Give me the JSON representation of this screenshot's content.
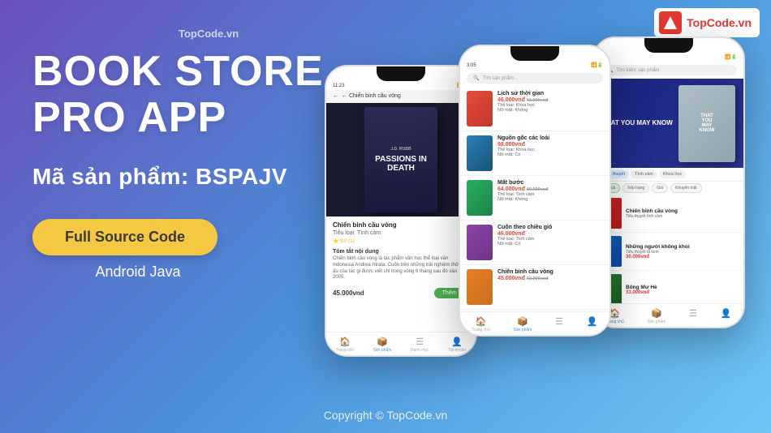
{
  "brand": {
    "logo_text": "T",
    "name_part1": "Top",
    "name_part2": "Code.vn",
    "watermark": "TopCode.vn"
  },
  "left": {
    "title_line1": "BOOK STORE",
    "title_line2": "PRO APP",
    "product_label": "Mã sản phẩm: BSPAJV",
    "btn_label": "Full Source Code",
    "platform": "Android Java"
  },
  "footer": {
    "copyright": "Copyright © TopCode.vn"
  },
  "phone_left": {
    "status_time": "11:23",
    "header": "← Chiến binh cầu vòng",
    "book_author": "J.D. ROBB",
    "book_title": "PASSIONS IN DEATH",
    "book_name": "Chiến binh cầu vòng",
    "genre": "Tiểu loại: Tình cảm",
    "rating": "⭐ 9.0 (1)",
    "summary_title": "Tóm tắt nội dung",
    "summary": "Chiến binh cầu vòng là tác phẩm văn học thể loại văn Indonesia Andrea Hirata. Cuốn trên những trải nghiệm thời thơ ấu của tác gi được viết chỉ trong vòng 6 tháng sau đó vào năm 2005.",
    "price": "45.000vnd",
    "add_btn": "Thêm v",
    "nav_items": [
      "Trang chủ",
      "Sản phẩm",
      "Danh mục",
      "Tài khoản"
    ]
  },
  "phone_middle": {
    "status_time": "3:05",
    "search_placeholder": "Tìm sản phẩm...",
    "books": [
      {
        "title": "Lịch sử thời gian",
        "price": "46.000vnđ",
        "old_price": "60.000vnđ",
        "type": "Thể loại: Khoa học",
        "borrow": "Nữ mặt: Không"
      },
      {
        "title": "Nguồn gốc các loài",
        "price": "98.000vnđ",
        "old_price": "",
        "type": "Thể loại: Khoa học",
        "borrow": "Nữ mặt: Có"
      },
      {
        "title": "Mất bước",
        "price": "64.000vnđ",
        "old_price": "80.000vnđ",
        "type": "Thể loại: Tình cảm",
        "borrow": "Nữ mặt: Không"
      },
      {
        "title": "Cuốn theo chiều gió",
        "price": "46.000vnđ",
        "old_price": "",
        "type": "Thể loại: Tình cảm",
        "borrow": "Nữ mặt: Có"
      },
      {
        "title": "Chiến binh cầu vòng",
        "price": "45.000vnđ",
        "old_price": "60.000vnđ",
        "type": "",
        "borrow": ""
      }
    ],
    "nav_items": [
      "Trang chủ",
      "Sản phẩm",
      "Danh mục",
      "Tài khoản"
    ]
  },
  "phone_right": {
    "search_placeholder": "Tìm kiếm sản phẩm",
    "featured_label": "THAT YOU\nMAY KNOW",
    "categories": [
      "Tiểu thuyết",
      "Tình cảm",
      "Khoa học"
    ],
    "active_cat": "Tiểu thuyết",
    "filters": [
      "Tất cả",
      "Xếp hạng",
      "Giá",
      "Khuyến mãi"
    ],
    "books": [
      {
        "title": "Chiến binh cầu vòng",
        "sub": "Tiểu thuyết tình cảm",
        "price": ""
      },
      {
        "title": "Những người không khỏi",
        "sub": "Tiểu thuyết tà kinh",
        "price": "30.000vnđ"
      },
      {
        "title": "Bông Mư Hè",
        "sub": "",
        "price": "33.000vnđ"
      }
    ],
    "nav_items": [
      "Trang chủ",
      "Sản phẩm",
      "Danh mục",
      "Tài khoản"
    ]
  }
}
